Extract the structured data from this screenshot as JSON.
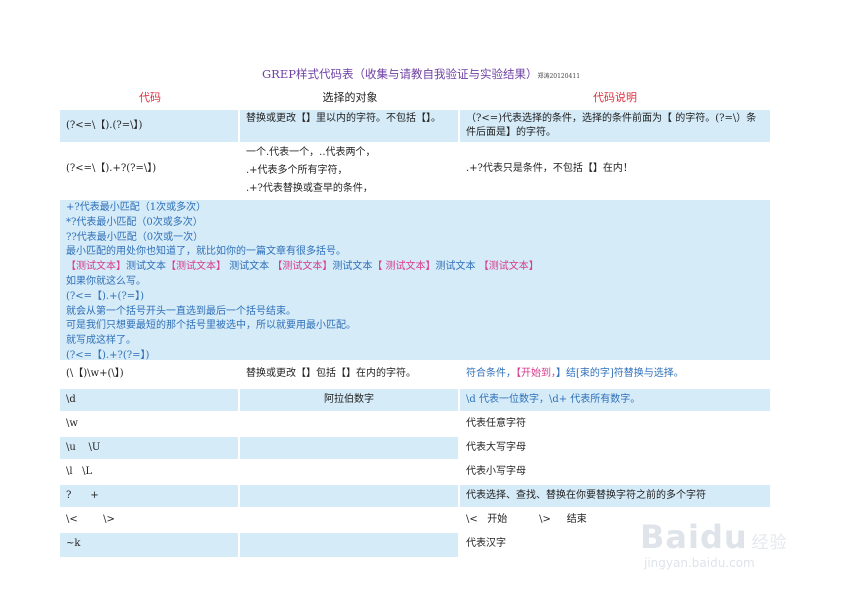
{
  "title": {
    "main": "GREP样式代码表（收集与请教自我验证与实验结果）",
    "suffix": "郑涛20120411"
  },
  "headers": {
    "code": "代码",
    "target": "选择的对象",
    "desc": "代码说明"
  },
  "rows": [
    {
      "code": "(?<=\\【).(?=\\】)",
      "target": "替换或更改【】里以内的字符。不包括【】。",
      "desc": "（?<=)代表选择的条件，选择的条件前面为【 的字符。(?=\\）条件后面是】的字符。"
    },
    {
      "code": "(?<=\\【).+?(?=\\】)",
      "target_lines": [
        "一个.代表一个，..代表两个，",
        ".+代表多个所有字符，",
        ".+?代表替换或查早的条件，"
      ],
      "desc": ".+?代表只是条件，不包括【】在内！"
    }
  ],
  "big_block": {
    "lines": [
      "+?代表最小匹配（1次或多次）",
      "*?代表最小匹配（0次或多次）",
      "??代表最小匹配（0次或一次）",
      "最小匹配的用处你也知道了，就比如你的一篇文章有很多括号。"
    ],
    "sample": [
      {
        "t": "【测试文本】",
        "c": "pink"
      },
      {
        "t": "测试文本",
        "c": "blue"
      },
      {
        "t": "【测试文本】",
        "c": "pink"
      },
      {
        "t": " 测试文本 ",
        "c": "blue"
      },
      {
        "t": "【测试文本】",
        "c": "pink"
      },
      {
        "t": "测试文本",
        "c": "blue"
      },
      {
        "t": "【 测试文本】",
        "c": "pink"
      },
      {
        "t": "测试文本 ",
        "c": "blue"
      },
      {
        "t": "【测试文本】",
        "c": "pink"
      }
    ],
    "lines2": [
      "如果你就这么写。",
      "(?<=【).+(?=】)",
      "就会从第一个括号开头一直选到最后一个括号结束。",
      "可是我们只想要最短的那个括号里被选中，所以就要用最小匹配。",
      "就写成这样了。",
      "(?<=【).+?(?=】)"
    ]
  },
  "row3": {
    "code": "(\\【)\\w+(\\】)",
    "target": "替换或更改【】包括【】在内的字符。",
    "desc_parts": [
      {
        "t": "符合条件，",
        "c": "blue"
      },
      {
        "t": "【开始到，",
        "c": "pink"
      },
      {
        "t": "】结[束的字]符替换与选择。",
        "c": "blue"
      }
    ]
  },
  "simple_rows": [
    {
      "code": "\\d",
      "target": "阿拉伯数字",
      "desc": "\\d 代表一位数字，\\d+ 代表所有数字。",
      "shaded": true,
      "desc_blue": true
    },
    {
      "code": "\\w",
      "target": "",
      "desc": "代表任意字符",
      "shaded": false,
      "desc_blue": false
    },
    {
      "code": "\\u    \\U",
      "target": "",
      "desc": "代表大写字母",
      "shaded": true,
      "desc_blue": false
    },
    {
      "code": "\\l   \\L",
      "target": "",
      "desc": "代表小写字母",
      "shaded": false,
      "desc_blue": false
    },
    {
      "code": "?      +",
      "target": "",
      "desc": "代表选择、查找、替换在你要替换字符之前的多个字符",
      "shaded": true,
      "desc_blue": false
    },
    {
      "code": "\\<        \\>",
      "target": "",
      "desc": "\\<   开始          \\>     结束",
      "shaded": false,
      "desc_blue": false
    },
    {
      "code": "~k",
      "target": "",
      "desc": "代表汉字",
      "shaded": true,
      "desc_blue": false
    }
  ],
  "watermark": {
    "logo": "Baidu",
    "suffix": "经验",
    "url": "jingyan.baidu.com"
  },
  "colors": {
    "shade": "#d5ebf8",
    "blue": "#2f70b8",
    "pink": "#d83a8d",
    "red": "#e0303e",
    "purple": "#6e3fa3"
  }
}
